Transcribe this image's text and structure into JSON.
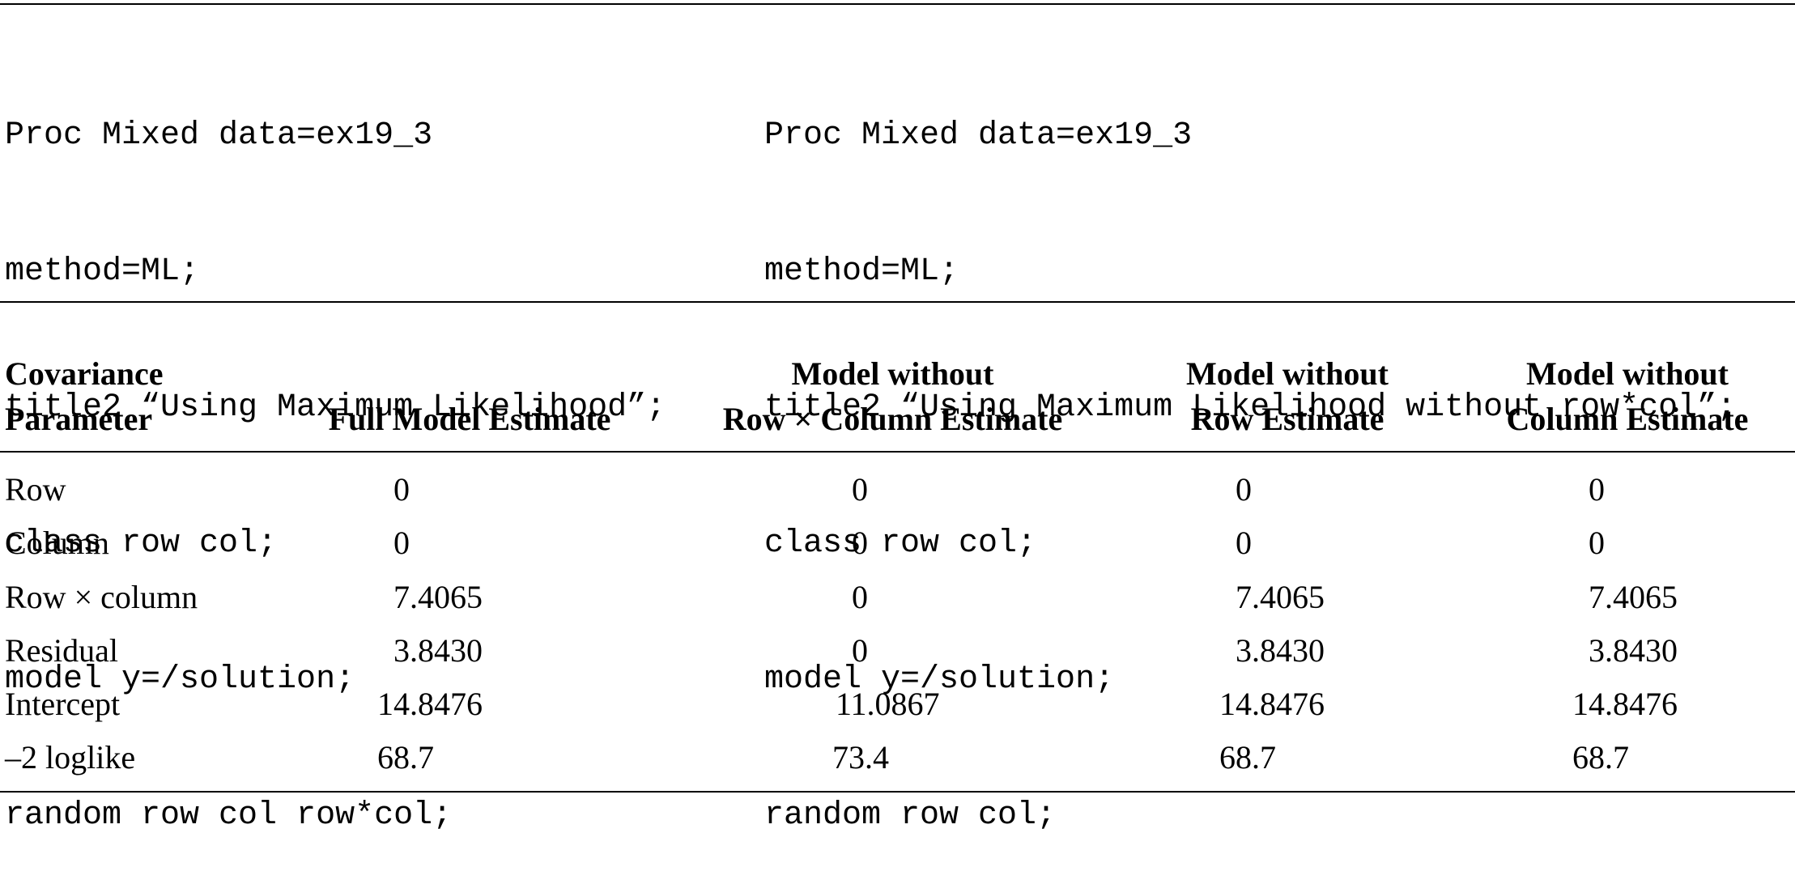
{
  "code_left": {
    "lines": [
      "Proc Mixed data=ex19_3",
      "method=ML;",
      "title2 “Using Maximum Likelihood”;",
      "class row col;",
      "model y=/solution;",
      "random row col row*col;"
    ]
  },
  "code_right": {
    "lines": [
      "Proc Mixed data=ex19_3",
      "method=ML;",
      "title2 “Using Maximum Likelihood without row*col”;",
      "class row col;",
      "model y=/solution;",
      "random row col;"
    ]
  },
  "table": {
    "headers": [
      {
        "line1": "Covariance",
        "line2": "Parameter"
      },
      {
        "line1": "",
        "line2": "Full Model Estimate"
      },
      {
        "line1": "Model without",
        "line2": "Row × Column Estimate"
      },
      {
        "line1": "Model without",
        "line2": "Row Estimate"
      },
      {
        "line1": "Model without",
        "line2": "Column Estimate"
      }
    ],
    "rows": [
      {
        "param": "Row",
        "full": "0",
        "no_rowcol": "0",
        "no_row": "0",
        "no_col": "0"
      },
      {
        "param": "Column",
        "full": "0",
        "no_rowcol": "0",
        "no_row": "0",
        "no_col": "0"
      },
      {
        "param": "Row × column",
        "full": "7.4065",
        "no_rowcol": "0",
        "no_row": "7.4065",
        "no_col": "7.4065"
      },
      {
        "param": "Residual",
        "full": "3.8430",
        "no_rowcol": "0",
        "no_row": "3.8430",
        "no_col": "3.8430"
      },
      {
        "param": "Intercept",
        "full": "14.8476",
        "no_rowcol": "11.0867",
        "no_row": "14.8476",
        "no_col": "14.8476"
      },
      {
        "param": "–2 loglike",
        "full": "68.7",
        "no_rowcol": "73.4",
        "no_row": "68.7",
        "no_col": "68.7"
      }
    ]
  }
}
